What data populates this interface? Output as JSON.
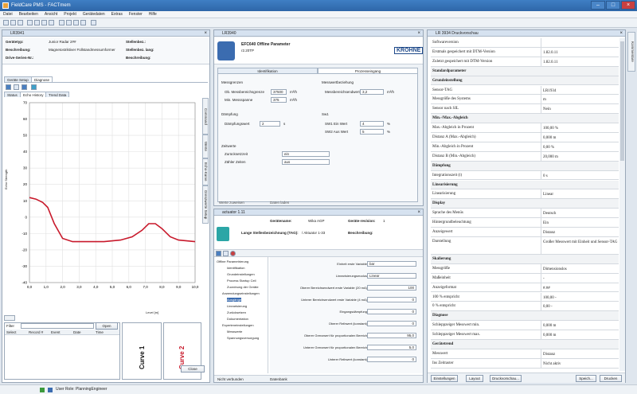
{
  "app": {
    "title": "FieldCare PMS - FACTmem"
  },
  "menu": [
    "Datei",
    "Bearbeiten",
    "Ansicht",
    "Projekt",
    "Gerätedaten",
    "Extras",
    "Fenster",
    "Hilfe"
  ],
  "left": {
    "title": "LR3941",
    "info": [
      {
        "label": "Gerätetyp:",
        "value": "Junior Radar 2##"
      },
      {
        "label": "Beschreibung:",
        "value": "Magnetostriktiver Füllstandmessumformer"
      },
      {
        "label": "Drive-Serien-Nr.:",
        "value": ""
      }
    ],
    "info_right": [
      {
        "label": "Stellenbez.:",
        "value": ""
      },
      {
        "label": "Stellenbez. lang:",
        "value": ""
      },
      {
        "label": "Beschreibung:",
        "value": ""
      }
    ],
    "tabs1": [
      "Geräte Setup",
      "Diagnose"
    ],
    "tabs2": [
      "Status",
      "Echo History",
      "Trend Data"
    ],
    "vtabs": [
      "Command",
      "Werte",
      "Echo-Kurve",
      "Grenzwerte Setup"
    ],
    "yaxis_label": "Echo Strength",
    "xaxis_label": "Level [m]",
    "y_ticks": [
      "70",
      "60",
      "50",
      "40",
      "30",
      "20",
      "10",
      "0",
      "-10",
      "-20",
      "-30",
      "-40"
    ],
    "x_ticks": [
      "0,0",
      "1,0",
      "2,0",
      "3,0",
      "4,0",
      "5,0",
      "6,0",
      "7,0",
      "8,0",
      "9,0",
      "10,0"
    ],
    "list_cols": [
      "Select",
      "Record #",
      "Event",
      "Date",
      "Time"
    ],
    "filter_label": "Filter",
    "open_button": "Open",
    "curve1": "Curve 1",
    "curve2": "Curve 2",
    "close_button": "Close"
  },
  "middle": {
    "title": "LR3940",
    "device_title": "EFC640 Offline Parameter",
    "device_sub": "r2.20TP",
    "brand": "KROHNE",
    "tabs": [
      "Identifikation",
      "Prozesseingang"
    ],
    "group1": "Messgrenzen",
    "f1": [
      {
        "label": "Ob. Messbereichsgrenze",
        "value": "37500",
        "unit": "m³/h"
      },
      {
        "label": "Min. Messspanne",
        "value": "375",
        "unit": "m³/h"
      }
    ],
    "group2": "Messwertbeziehung",
    "f2": [
      {
        "label": "Messbereichsendwert",
        "value": "3,2",
        "unit": "m³/h"
      }
    ],
    "group3": "Dämpfung",
    "f3": [
      {
        "label": "Dämpfungswert",
        "value": "2",
        "unit": "s"
      }
    ],
    "group4": "Sw1",
    "f4": [
      {
        "label": "SW1 Ein Wert",
        "value": "4",
        "unit": "%"
      },
      {
        "label": "SW2 Aus Wert",
        "value": "5",
        "unit": "%"
      }
    ],
    "group5": "Zeitwerte",
    "f5": [
      {
        "label": "Zurücksetzzeit",
        "value": "ein"
      },
      {
        "label": "Zähler Zeiten",
        "value": "aus"
      }
    ],
    "bottom_label1": "Werte zuweisen",
    "bottom_label2": "Daten laden",
    "sub_title": "actuator 1.11",
    "sub_info": [
      {
        "label": "Gerätename:",
        "value": "Wika AGP"
      },
      {
        "label": "Geräte-revision:",
        "value": "1"
      },
      {
        "label": "Lange Stellenbezeichnung (TAG):",
        "value": "/ Aktuator 1-33"
      },
      {
        "label": "Beschreibung:",
        "value": ""
      }
    ],
    "tree": [
      "Offline Parametrierung",
      "Identifikation",
      "Grundeinstellungen",
      "Process Startup Cell",
      "Zuordnung der Geräte",
      "Anwendungseinstellungen",
      "Ausgänge",
      "Linearisierung",
      "Zurücksetzen",
      "Dokumentation",
      "Experteneinstellungen",
      "Messwerte",
      "Spannungsversorgung"
    ],
    "params": [
      {
        "label": "Einheit erste Variable",
        "value": "bar"
      },
      {
        "label": "Linearisierungsmodus",
        "value": "Linear"
      },
      {
        "label": "Oberer Bereichsendwert erste Variable (20 mA)",
        "value": "100"
      },
      {
        "label": "Unterer Bereichsendwert erste Variable (4 mA)",
        "value": "0"
      },
      {
        "label": "Eingangsdämpfung",
        "value": "0"
      },
      {
        "label": "Oberer Reibwert (konstant)",
        "value": "0"
      },
      {
        "label": "Oberer Grenzwert für proportionalen Bereich",
        "value": "95,0"
      },
      {
        "label": "Unterer Grenzwert für proportionalen Bereich",
        "value": "5,0"
      },
      {
        "label": "Unterer Reibwert (konstant)",
        "value": "0"
      }
    ],
    "status_left": "Nicht verbunden",
    "status_right": "Datenbank"
  },
  "right": {
    "title": "LR 3934 Druckvorschau",
    "rows": [
      {
        "l": "Softwareversion",
        "v": "",
        "s": false
      },
      {
        "l": "Erstmals gespeichert mit DTM-Version",
        "v": "1.82.0.11",
        "s": false
      },
      {
        "l": "Zuletzt gespeichert mit DTM-Version",
        "v": "1.82.0.11",
        "s": false
      },
      {
        "l": "Standardparameter",
        "v": "",
        "s": true
      },
      {
        "l": "Grundeinstellung",
        "v": "",
        "s": true
      },
      {
        "l": "Sensor-TAG",
        "v": "LR1934",
        "s": false
      },
      {
        "l": "Messgröße des Systems",
        "v": "m",
        "s": false
      },
      {
        "l": "Sensor nach SIL",
        "v": "Nein",
        "s": false
      },
      {
        "l": "Min.-/Max.-Abgleich",
        "v": "",
        "s": true
      },
      {
        "l": "Max.-Abgleich in Prozent",
        "v": "100,00 %",
        "s": false
      },
      {
        "l": "Distanz A (Max.-Abgleich)",
        "v": "0,000 m",
        "s": false
      },
      {
        "l": "Min.-Abgleich in Prozent",
        "v": "0,00 %",
        "s": false
      },
      {
        "l": "Distanz B (Min.-Abgleich)",
        "v": "20,000 m",
        "s": false
      },
      {
        "l": "Dämpfung",
        "v": "",
        "s": true
      },
      {
        "l": "Integrationszeit (t)",
        "v": "0 s",
        "s": false
      },
      {
        "l": "Linearisierung",
        "v": "",
        "s": true
      },
      {
        "l": "Linearisierung",
        "v": "Linear",
        "s": false
      },
      {
        "l": "Display",
        "v": "",
        "s": true
      },
      {
        "l": "Sprache des Menüs",
        "v": "Deutsch",
        "s": false
      },
      {
        "l": "Hintergrundbeleuchtung",
        "v": "Ein",
        "s": false
      },
      {
        "l": "Anzeigewert",
        "v": "Distanz",
        "s": false
      },
      {
        "l": "Darstellung",
        "v": "Großer Messwert mit Einheit und Sensor-TAG",
        "s": false,
        "tall": true
      },
      {
        "l": "Skalierung",
        "v": "",
        "s": true
      },
      {
        "l": "Messgröße",
        "v": "Dimensionslos",
        "s": false
      },
      {
        "l": "Maßeinheit",
        "v": "-",
        "s": false
      },
      {
        "l": "Anzeigeformat",
        "v": "#.##",
        "s": false
      },
      {
        "l": "100 % entspricht",
        "v": "100,00 -",
        "s": false
      },
      {
        "l": "0 % entspricht",
        "v": "0,00 -",
        "s": false
      },
      {
        "l": "Diagnose",
        "v": "",
        "s": true
      },
      {
        "l": "Schleppzeiger Messwert min.",
        "v": "0,000 m",
        "s": false
      },
      {
        "l": "Schleppzeiger Messwert max.",
        "v": "0,000 m",
        "s": false
      },
      {
        "l": "Gerätetrend",
        "v": "",
        "s": true
      },
      {
        "l": "Messwert",
        "v": "Distanz",
        "s": false
      },
      {
        "l": "Ins Zeitraster",
        "v": "Nicht aktiv",
        "s": false
      }
    ],
    "buttons": [
      "Einstellungen",
      "Layout",
      "Druckvorschau...",
      "Speich...",
      "Drucken"
    ],
    "side_tab": "Kommentare"
  },
  "statusbar": {
    "text": "User Role: PlanningEngineer"
  },
  "colors": {
    "curve": "#c8192b",
    "accent": "#2e66a8"
  }
}
